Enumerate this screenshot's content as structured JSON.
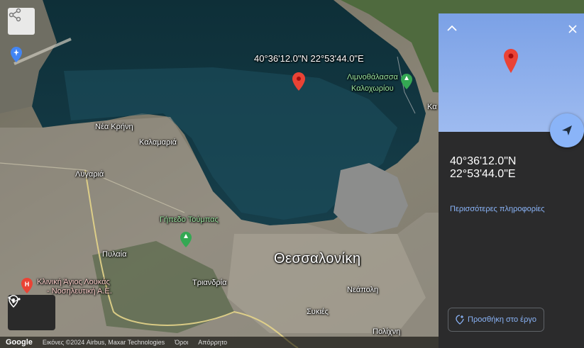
{
  "map": {
    "coord_label": "40°36'12.0\"N 22°53'44.0\"E",
    "labels": {
      "nea_krini": "Νέα Κρήνη",
      "kalamaria": "Καλαμαριά",
      "lygaria": "Λυγαριά",
      "gipedo_toumbas": "Γήπεδο Τούμπας",
      "pylaia": "Πυλαία",
      "thessaloniki": "Θεσσαλονίκη",
      "triandria": "Τριανδρία",
      "neapoli": "Νεάπολη",
      "sykies": "Συκιές",
      "polichni": "Πολίχνη",
      "limnothalassa": "Λιμνοθάλασσα",
      "kalochoriou": "Καλοχωρίου",
      "klinik_line1": "Κλινική Άγιος Λουκάς",
      "klinik_line2": "- Νοσηλευτική Α.Ε.",
      "partial_ka": "Κα"
    },
    "bottom_bar": {
      "brand": "Google",
      "attribution": "Εικόνες ©2024 Airbus, Maxar Technologies",
      "terms": "Όροι",
      "privacy": "Απόρρητο"
    }
  },
  "panel": {
    "coord": "40°36'12.0\"N 22°53'44.0\"E",
    "more_info": "Περισσότερες πληροφορίες",
    "add_to_project": "Προσθήκη στο έργο"
  },
  "colors": {
    "accent": "#8ab4f8",
    "panel_bg": "#2b2b2c",
    "pin": "#ea4335"
  }
}
